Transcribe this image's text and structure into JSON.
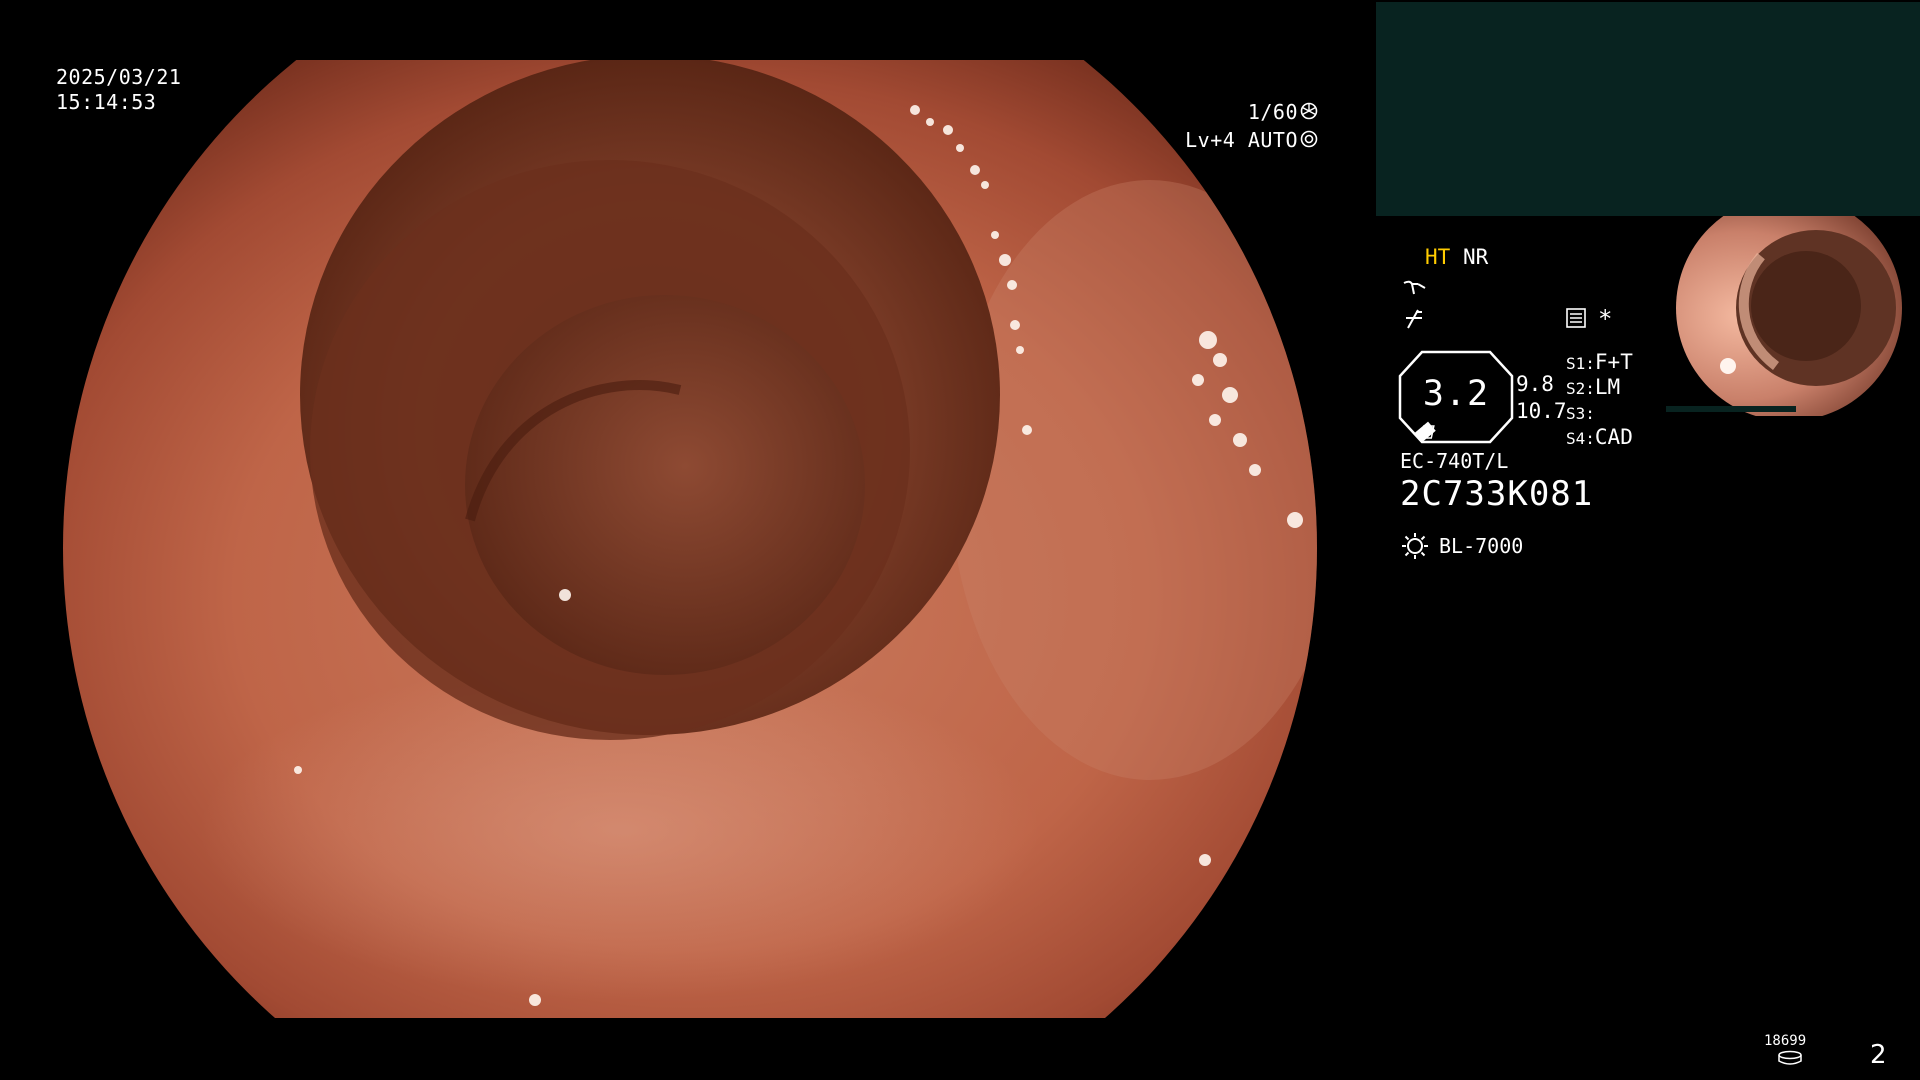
{
  "overlay": {
    "date": "2025/03/21",
    "time": "15:14:53",
    "shutter": "1/60",
    "iris": "Lv+4 AUTO"
  },
  "status_panel": {
    "ht": "HT",
    "nr": "NR",
    "enhancement_value": "3.2",
    "value_upper": "9.8",
    "value_lower": "10.7",
    "switches": [
      {
        "key": "S1:",
        "value": "F+T"
      },
      {
        "key": "S2:",
        "value": "LM"
      },
      {
        "key": "S3:",
        "value": ""
      },
      {
        "key": "S4:",
        "value": "CAD"
      }
    ],
    "scope_model": "EC-740T/L",
    "serial": "2C733K081",
    "light_source": "BL-7000"
  },
  "footer": {
    "counter": "18699",
    "page_number": "2"
  },
  "icons": [
    "shutter-icon",
    "auto-iris-icon",
    "pump-icon",
    "air-water-icon",
    "menu-icon",
    "asterisk-icon",
    "light-source-icon",
    "storage-icon"
  ],
  "colors": {
    "highlight": "#ffcc00",
    "pip_panel": "#082320",
    "background": "#000000"
  }
}
